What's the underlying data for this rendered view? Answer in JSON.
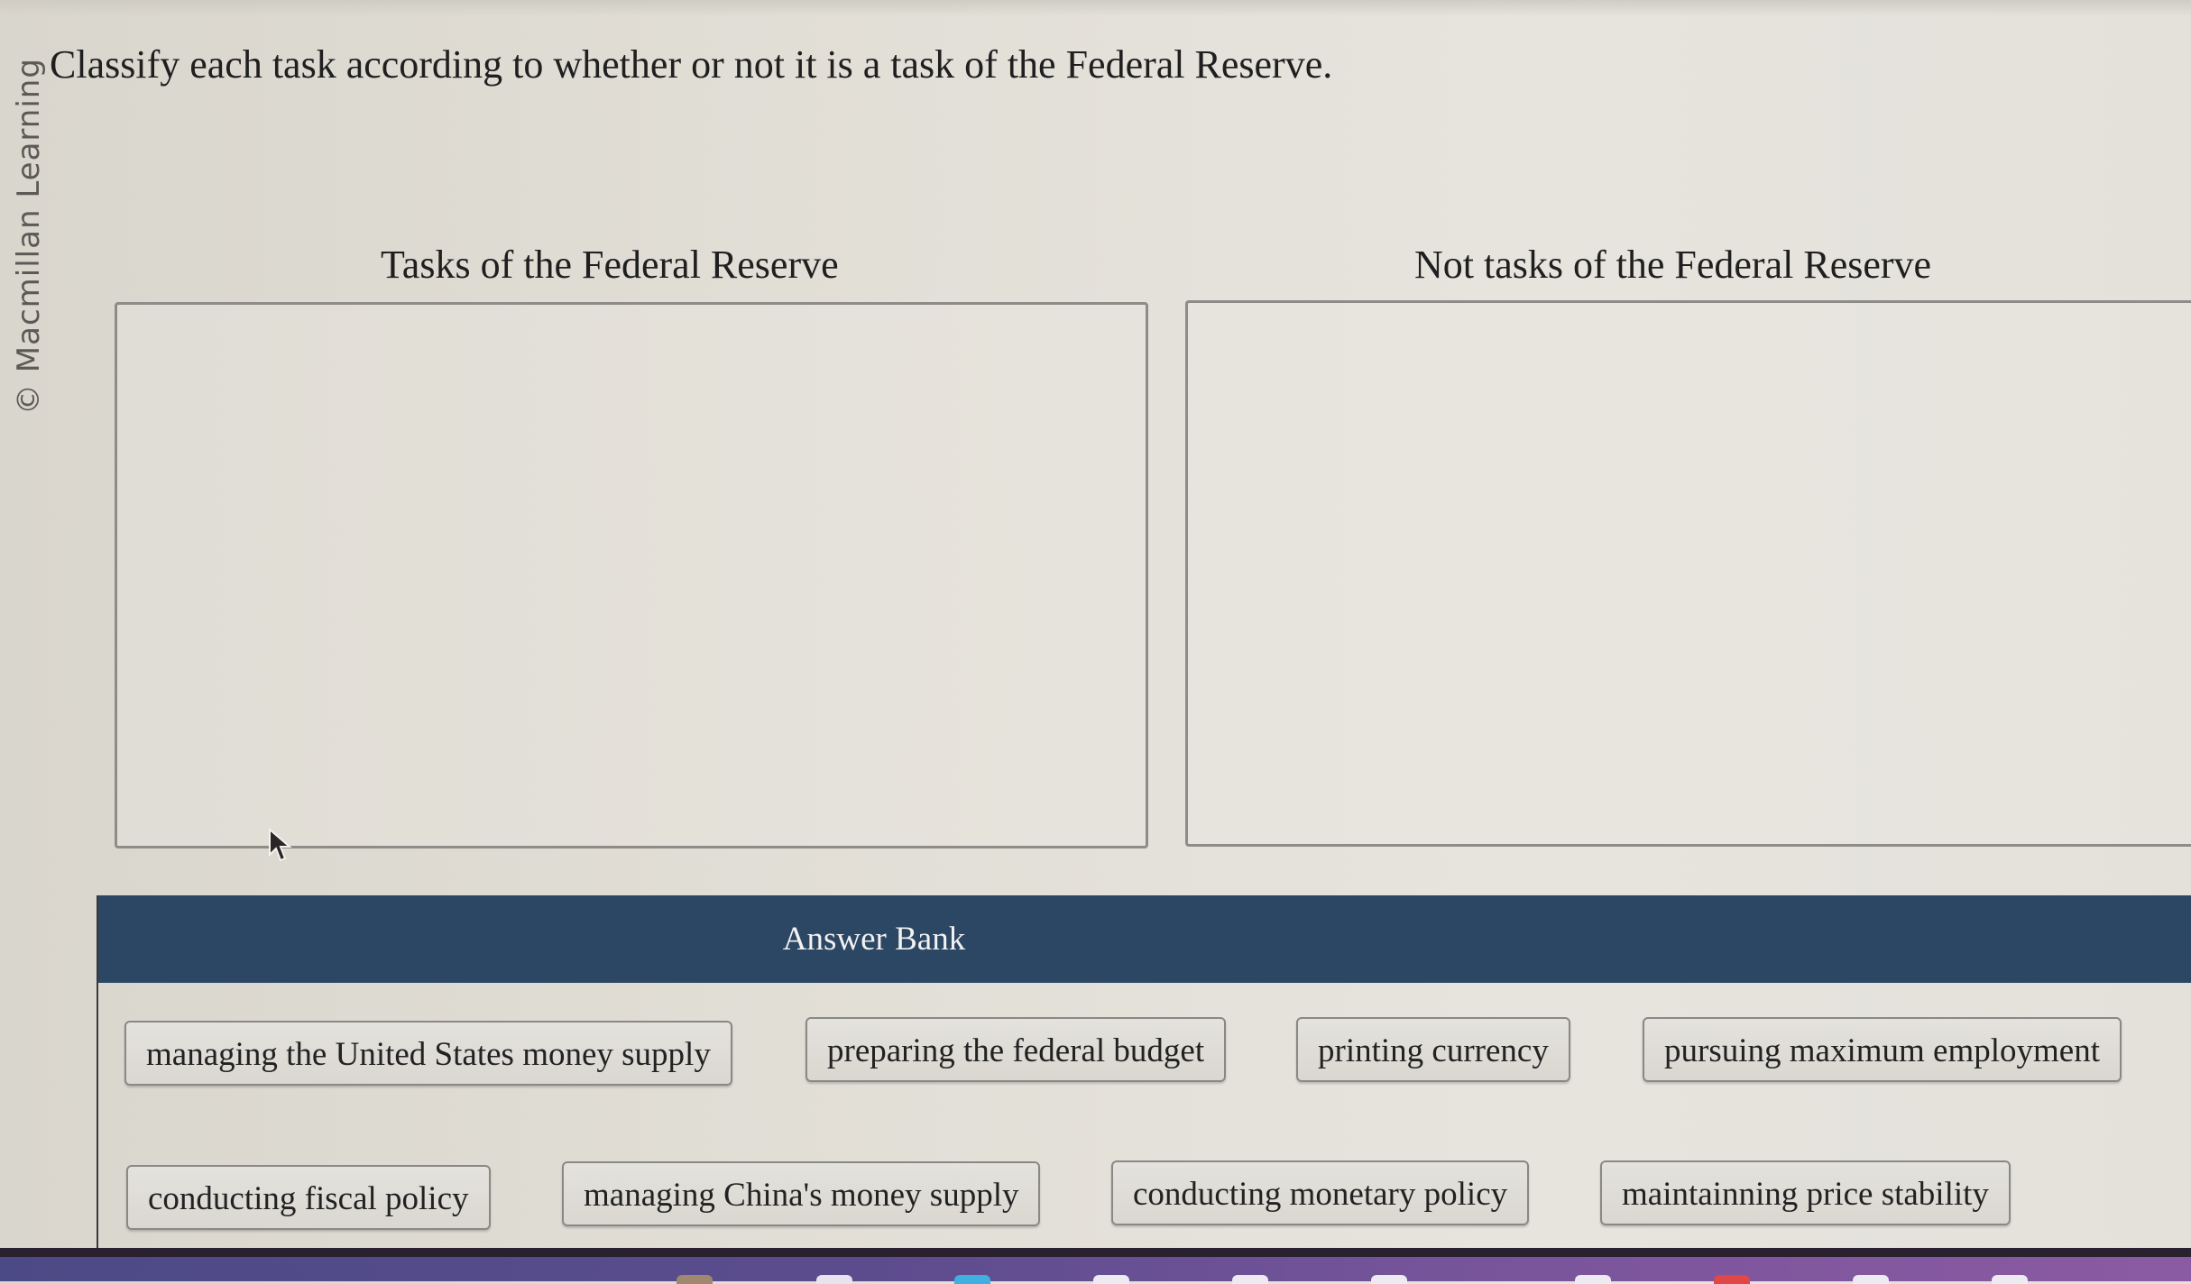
{
  "watermark": "© Macmillan Learning",
  "question": {
    "prompt": "Classify each task according to whether or not it is a task of the Federal Reserve."
  },
  "categories": [
    {
      "label": "Tasks of the Federal Reserve",
      "items": []
    },
    {
      "label": "Not tasks of the Federal Reserve",
      "items": []
    }
  ],
  "answer_bank": {
    "title": "Answer Bank",
    "items": [
      "managing the United States money supply",
      "preparing the federal budget",
      "printing currency",
      "pursuing maximum employment",
      "conducting fiscal policy",
      "managing China's money supply",
      "conducting monetary policy",
      "maintainning price stability"
    ]
  },
  "colors": {
    "bank_header": "#2c4763",
    "background": "#e2dfd7",
    "dock": "#6a5296"
  }
}
